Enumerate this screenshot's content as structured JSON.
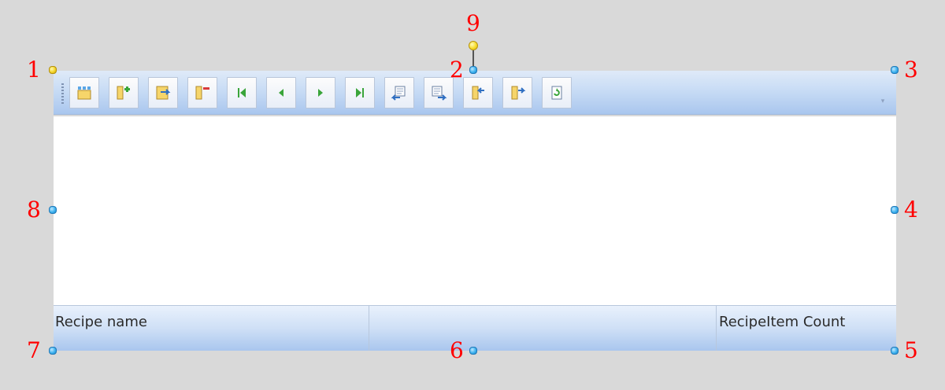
{
  "toolbar": {
    "buttons": [
      {
        "icon": "insert-icon"
      },
      {
        "icon": "add-row-icon"
      },
      {
        "icon": "edit-row-icon"
      },
      {
        "icon": "delete-row-icon"
      },
      {
        "icon": "first-record-icon"
      },
      {
        "icon": "previous-record-icon"
      },
      {
        "icon": "next-record-icon"
      },
      {
        "icon": "last-record-icon"
      },
      {
        "icon": "import-icon"
      },
      {
        "icon": "export-icon"
      },
      {
        "icon": "move-in-icon"
      },
      {
        "icon": "move-out-icon"
      },
      {
        "icon": "refresh-icon"
      }
    ]
  },
  "footer": {
    "columns": [
      "Recipe name",
      "",
      "RecipeItem Count"
    ]
  },
  "callouts": [
    "1",
    "2",
    "3",
    "4",
    "5",
    "6",
    "7",
    "8",
    "9"
  ],
  "colors": {
    "callout": "#ff0000",
    "handle": "#3fb3ef",
    "rotate_handle": "#f4d52b",
    "toolbar": "#c8dcf5"
  }
}
